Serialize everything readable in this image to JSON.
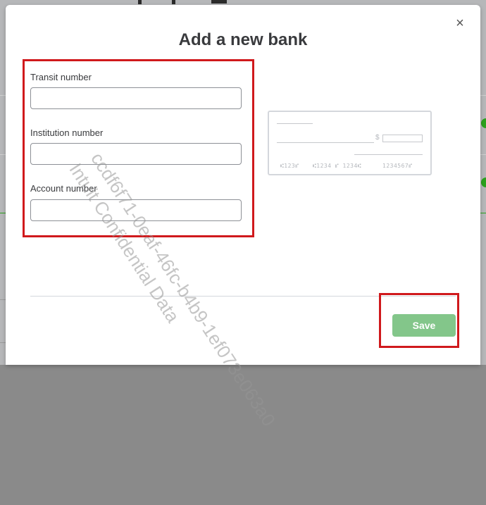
{
  "modal": {
    "title": "Add a new bank",
    "close_icon": "close-icon",
    "close_glyph": "×"
  },
  "form": {
    "transit_label": "Transit number",
    "transit_value": "",
    "institution_label": "Institution number",
    "institution_value": "",
    "account_label": "Account number",
    "account_value": ""
  },
  "cheque": {
    "dollar_sign": "$",
    "micr_transit": "⑆123⑈",
    "micr_institution": "⑆1234 ⑈ 1234⑆",
    "micr_account": "1234567⑈"
  },
  "footer": {
    "save_label": "Save"
  },
  "watermark": {
    "line1": "ccdf6f71-0eaf-46fc-b4b9-1ef073e063a0",
    "line2": "Intuit Confidential Data"
  },
  "colors": {
    "highlight_box": "#d0191c",
    "save_button": "#83c68a",
    "title": "#393a3d"
  }
}
